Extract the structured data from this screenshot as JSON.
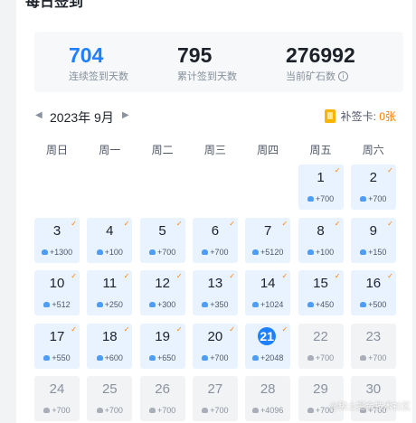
{
  "page": {
    "title": "每日签到"
  },
  "stats": [
    {
      "value": "704",
      "label": "连续签到天数",
      "highlight": true
    },
    {
      "value": "795",
      "label": "累计签到天数",
      "highlight": false
    },
    {
      "value": "276992",
      "label": "当前矿石数",
      "highlight": false,
      "info": "i"
    }
  ],
  "calendar": {
    "prev_icon": "◀",
    "next_icon": "▶",
    "month_label": "2023年 9月",
    "card_label": "补签卡: ",
    "card_count": "0",
    "card_unit": "张",
    "weekdays": [
      "周日",
      "周一",
      "周二",
      "周三",
      "周四",
      "周五",
      "周六"
    ],
    "check_icon": "✓",
    "days": [
      {
        "day": "1",
        "points": "+700",
        "signed": true,
        "future": false,
        "today": false
      },
      {
        "day": "2",
        "points": "+700",
        "signed": true,
        "future": false,
        "today": false
      },
      {
        "day": "3",
        "points": "+1300",
        "signed": true,
        "future": false,
        "today": false
      },
      {
        "day": "4",
        "points": "+100",
        "signed": true,
        "future": false,
        "today": false
      },
      {
        "day": "5",
        "points": "+700",
        "signed": true,
        "future": false,
        "today": false
      },
      {
        "day": "6",
        "points": "+700",
        "signed": true,
        "future": false,
        "today": false
      },
      {
        "day": "7",
        "points": "+5120",
        "signed": true,
        "future": false,
        "today": false
      },
      {
        "day": "8",
        "points": "+100",
        "signed": true,
        "future": false,
        "today": false
      },
      {
        "day": "9",
        "points": "+150",
        "signed": true,
        "future": false,
        "today": false
      },
      {
        "day": "10",
        "points": "+512",
        "signed": true,
        "future": false,
        "today": false
      },
      {
        "day": "11",
        "points": "+250",
        "signed": true,
        "future": false,
        "today": false
      },
      {
        "day": "12",
        "points": "+300",
        "signed": true,
        "future": false,
        "today": false
      },
      {
        "day": "13",
        "points": "+350",
        "signed": true,
        "future": false,
        "today": false
      },
      {
        "day": "14",
        "points": "+1024",
        "signed": true,
        "future": false,
        "today": false
      },
      {
        "day": "15",
        "points": "+450",
        "signed": true,
        "future": false,
        "today": false
      },
      {
        "day": "16",
        "points": "+500",
        "signed": true,
        "future": false,
        "today": false
      },
      {
        "day": "17",
        "points": "+550",
        "signed": true,
        "future": false,
        "today": false
      },
      {
        "day": "18",
        "points": "+600",
        "signed": true,
        "future": false,
        "today": false
      },
      {
        "day": "19",
        "points": "+650",
        "signed": true,
        "future": false,
        "today": false
      },
      {
        "day": "20",
        "points": "+700",
        "signed": true,
        "future": false,
        "today": false
      },
      {
        "day": "21",
        "points": "+2048",
        "signed": true,
        "future": false,
        "today": true
      },
      {
        "day": "22",
        "points": "+700",
        "signed": false,
        "future": true,
        "today": false
      },
      {
        "day": "23",
        "points": "+700",
        "signed": false,
        "future": true,
        "today": false
      },
      {
        "day": "24",
        "points": "+700",
        "signed": false,
        "future": true,
        "today": false
      },
      {
        "day": "25",
        "points": "+700",
        "signed": false,
        "future": true,
        "today": false
      },
      {
        "day": "26",
        "points": "+700",
        "signed": false,
        "future": true,
        "today": false
      },
      {
        "day": "27",
        "points": "+700",
        "signed": false,
        "future": true,
        "today": false
      },
      {
        "day": "28",
        "points": "+4096",
        "signed": false,
        "future": true,
        "today": false
      },
      {
        "day": "29",
        "points": "+700",
        "signed": false,
        "future": true,
        "today": false
      },
      {
        "day": "30",
        "points": "+700",
        "signed": false,
        "future": true,
        "today": false
      }
    ]
  },
  "watermark": "@稀土掘金技术社区",
  "colors": {
    "accent": "#1e80ff",
    "signed_bg": "#e8f3ff",
    "future_bg": "#f2f3f5",
    "check": "#ff7d00"
  }
}
